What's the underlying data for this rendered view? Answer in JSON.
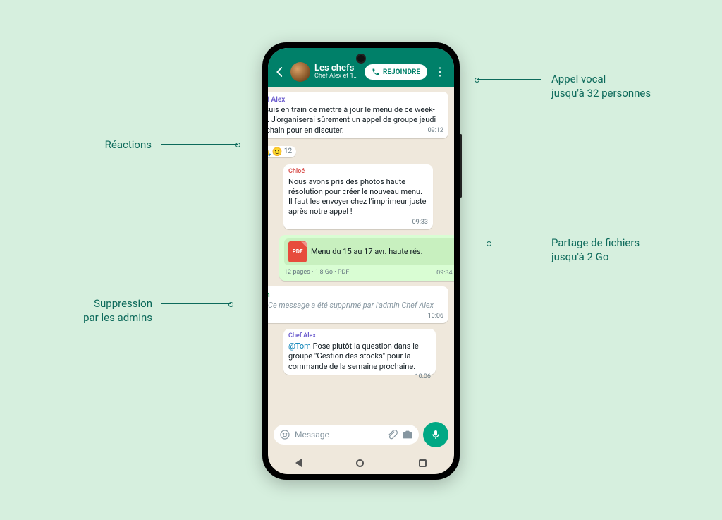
{
  "header": {
    "title": "Les chefs",
    "subtitle": "Chef Alex et 14 ...",
    "join_label": "REJOINDRE"
  },
  "messages": {
    "m1": {
      "sender": "Chef Alex",
      "text": "Je suis en train de mettre à jour le menu de ce week-end. J'organiserai sûrement un appel de groupe jeudi prochain pour en discuter.",
      "time": "09:12",
      "reactions": {
        "emojis": "👍🙏🙂",
        "count": "12"
      }
    },
    "m2": {
      "sender": "Chloé",
      "text": "Nous avons pris des photos haute résolution pour créer le nouveau menu. Il faut les envoyer chez l'imprimeur juste après notre appel !",
      "time": "09:33"
    },
    "m3": {
      "pdf_label": "PDF",
      "file_name": "Menu du 15 au 17 avr. haute rés.",
      "pages": "12 pages",
      "size": "1,8 Go",
      "type": "PDF",
      "time": "09:34"
    },
    "m4": {
      "sender": "Tom",
      "text": "Ce message a été supprimé par l'admin Chef Alex",
      "time": "10:06"
    },
    "m5": {
      "sender": "Chef Alex",
      "mention": "@Tom",
      "text": " Pose plutôt la question dans le groupe \"Gestion des stocks\" pour la commande de la semaine prochaine.",
      "time": "10:06"
    }
  },
  "input": {
    "placeholder": "Message"
  },
  "annotations": {
    "reactions": "Réactions",
    "admin_delete_l1": "Suppression",
    "admin_delete_l2": "par les admins",
    "voice_l1": "Appel vocal",
    "voice_l2": "jusqu'à 32 personnes",
    "files_l1": "Partage de fichiers",
    "files_l2": "jusqu'à 2 Go"
  }
}
